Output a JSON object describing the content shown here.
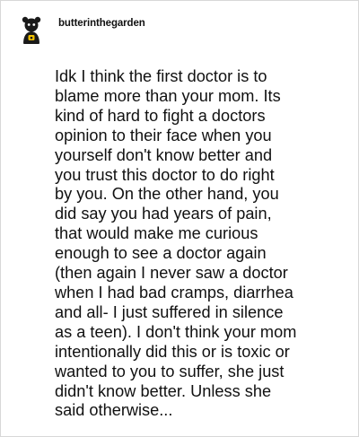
{
  "post": {
    "avatar": {
      "icon": "avatar-icon",
      "bg_color": "#ffffff",
      "figure_color": "#1a1a1a",
      "accent_color": "#f2c200"
    },
    "username": "butterinthegarden",
    "body_text": "Idk I think the first doctor is to\nblame more than your mom. Its\nkind of hard to fight a doctors\nopinion to their face when you\nyourself don't know better and\nyou trust this doctor to do right\nby you. On the other hand, you\ndid say you had years of pain,\nthat would make me curious\nenough to see a doctor again\n(then again I never saw a doctor\nwhen I had bad cramps, diarrhea\nand all- I just suffered in silence\nas a teen). I don't think your mom\nintentionally did this or is toxic or\nwanted to you to suffer, she just\ndidn't know better. Unless she\nsaid otherwise..."
  }
}
